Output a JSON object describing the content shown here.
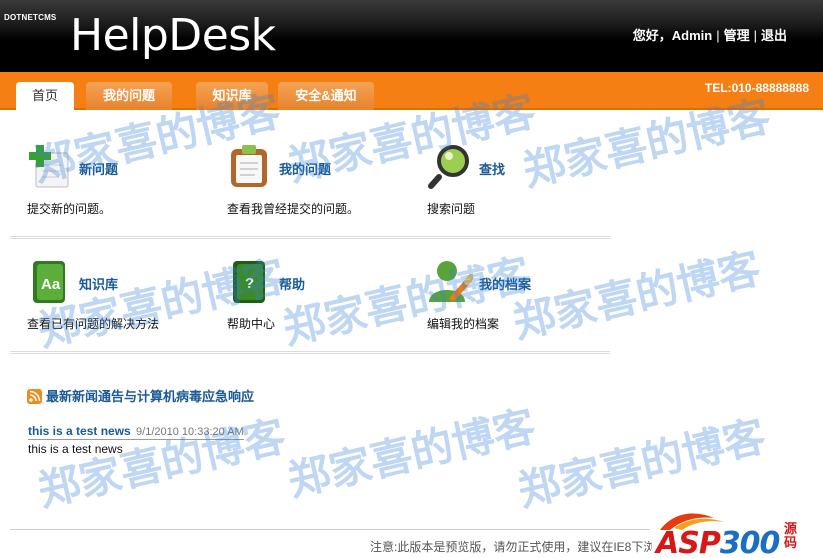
{
  "header": {
    "brand_small": "DOTNETCMS",
    "logo": "HelpDesk",
    "greeting": "您好，Admin",
    "manage_link": "管理",
    "logout_link": "退出"
  },
  "nav": {
    "tabs": [
      {
        "label": "首页",
        "active": true
      },
      {
        "label": "我的问题"
      },
      {
        "label": "知识库"
      },
      {
        "label": "安全&通知"
      }
    ],
    "tel": "TEL:010-88888888"
  },
  "items": [
    {
      "title": "新问题",
      "desc": "提交新的问题。",
      "icon": "new-question-icon"
    },
    {
      "title": "我的问题",
      "desc": "查看我曾经提交的问题。",
      "icon": "clipboard-icon"
    },
    {
      "title": "查找",
      "desc": "搜索问题",
      "icon": "magnifier-icon"
    },
    {
      "title": "知识库",
      "desc": "查看已有问题的解决方法",
      "icon": "book-icon"
    },
    {
      "title": "帮助",
      "desc": "帮助中心",
      "icon": "help-book-icon"
    },
    {
      "title": "我的档案",
      "desc": "编辑我的档案",
      "icon": "user-profile-icon"
    }
  ],
  "news": {
    "title": "最新新闻通告与计算机病毒应急响应",
    "item_link": "this is a test news",
    "item_date": "9/1/2010 10:33:20 AM",
    "item_body": "this is a test news"
  },
  "footer": {
    "note": "注意:此版本是预览版，请勿正式使用，建议在IE8下浏"
  },
  "brandmark": {
    "asp": "ASP",
    "num": "300",
    "suffix": "源码"
  },
  "watermark": "郑家喜的博客",
  "colors": {
    "nav_bar": "#f57f12",
    "link": "#1b5a94",
    "header": "#000000"
  }
}
